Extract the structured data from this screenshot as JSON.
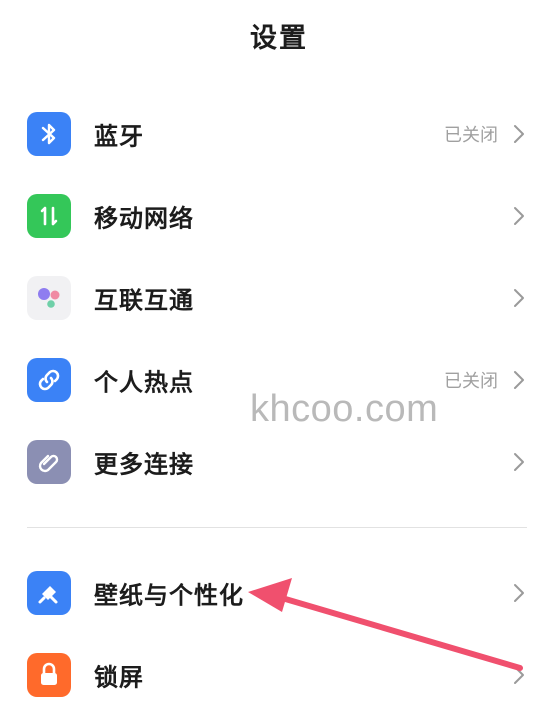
{
  "header": {
    "title": "设置"
  },
  "settings": {
    "items": [
      {
        "label": "蓝牙",
        "status": "已关闭",
        "icon": "bluetooth-icon",
        "color": "#3b82f6"
      },
      {
        "label": "移动网络",
        "status": "",
        "icon": "mobile-network-icon",
        "color": "#34c759"
      },
      {
        "label": "互联互通",
        "status": "",
        "icon": "interconnect-icon",
        "color": "#f1f1f3"
      },
      {
        "label": "个人热点",
        "status": "已关闭",
        "icon": "hotspot-icon",
        "color": "#3b82f6"
      },
      {
        "label": "更多连接",
        "status": "",
        "icon": "more-connections-icon",
        "color": "#8b8fb3"
      },
      {
        "label": "壁纸与个性化",
        "status": "",
        "icon": "wallpaper-icon",
        "color": "#3b82f6"
      },
      {
        "label": "锁屏",
        "status": "",
        "icon": "lock-icon",
        "color": "#ff6a2b"
      }
    ]
  },
  "overlay": {
    "watermark": "khcoo.com",
    "arrow_color": "#f0506e"
  }
}
